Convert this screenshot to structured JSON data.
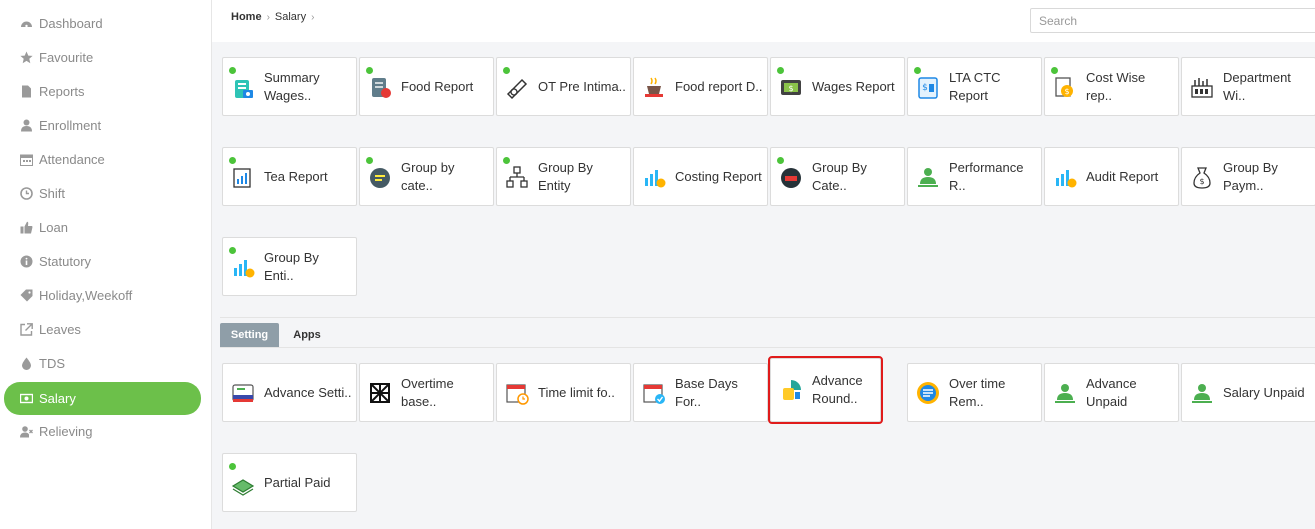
{
  "sidebar": {
    "items": [
      {
        "label": "Dashboard",
        "icon": "dashboard-icon"
      },
      {
        "label": "Favourite",
        "icon": "star-icon"
      },
      {
        "label": "Reports",
        "icon": "file-icon"
      },
      {
        "label": "Enrollment",
        "icon": "user-icon"
      },
      {
        "label": "Attendance",
        "icon": "calendar-icon"
      },
      {
        "label": "Shift",
        "icon": "clock-icon"
      },
      {
        "label": "Loan",
        "icon": "thumbs-up-icon"
      },
      {
        "label": "Statutory",
        "icon": "info-icon"
      },
      {
        "label": "Holiday,Weekoff",
        "icon": "tag-icon"
      },
      {
        "label": "Leaves",
        "icon": "external-link-icon"
      },
      {
        "label": "TDS",
        "icon": "drop-icon"
      },
      {
        "label": "Salary",
        "icon": "money-icon"
      },
      {
        "label": "Relieving",
        "icon": "user-times-icon"
      }
    ],
    "active": "Salary"
  },
  "breadcrumb": {
    "home": "Home",
    "current": "Salary"
  },
  "search": {
    "placeholder": "Search"
  },
  "reports": [
    {
      "label": "Summary Wages..",
      "icon": "summary-wages-icon"
    },
    {
      "label": "Food Report",
      "icon": "food-report-icon"
    },
    {
      "label": "OT Pre Intima..",
      "icon": "ot-pre-intimation-icon"
    },
    {
      "label": "Food report D..",
      "icon": "food-report-d-icon"
    },
    {
      "label": "Wages Report",
      "icon": "wages-report-icon"
    },
    {
      "label": "LTA CTC Report",
      "icon": "lta-ctc-icon"
    },
    {
      "label": "Cost Wise rep..",
      "icon": "cost-wise-icon"
    },
    {
      "label": "Department Wi..",
      "icon": "department-icon"
    },
    {
      "label": "Tea Report",
      "icon": "tea-report-icon"
    },
    {
      "label": "Group by cate..",
      "icon": "group-by-category-icon"
    },
    {
      "label": "Group By Entity",
      "icon": "group-by-entity-icon"
    },
    {
      "label": "Costing Report",
      "icon": "costing-report-icon"
    },
    {
      "label": "Group By Cate..",
      "icon": "group-by-cate-icon"
    },
    {
      "label": "Performance R..",
      "icon": "performance-icon"
    },
    {
      "label": "Audit Report",
      "icon": "audit-report-icon"
    },
    {
      "label": "Group By Paym..",
      "icon": "group-by-payment-icon"
    },
    {
      "label": "Group By Enti..",
      "icon": "group-by-enti-icon"
    }
  ],
  "tabs": [
    {
      "label": "Setting",
      "active": true
    },
    {
      "label": "Apps",
      "active": false
    }
  ],
  "settings": [
    {
      "label": "Advance Setti..",
      "icon": "advance-settings-icon"
    },
    {
      "label": "Overtime base..",
      "icon": "overtime-base-icon"
    },
    {
      "label": "Time limit fo..",
      "icon": "time-limit-icon"
    },
    {
      "label": "Base Days For..",
      "icon": "base-days-icon"
    },
    {
      "label": "Advance Round..",
      "icon": "advance-round-icon",
      "highlighted": true
    },
    {
      "label": "Over time Rem..",
      "icon": "overtime-rem-icon"
    },
    {
      "label": "Advance Unpaid",
      "icon": "advance-unpaid-icon"
    },
    {
      "label": "Salary Unpaid",
      "icon": "salary-unpaid-icon"
    },
    {
      "label": "Partial Paid",
      "icon": "partial-paid-icon"
    }
  ],
  "colors": {
    "accent": "#6cc04a",
    "highlight": "#e01b1b",
    "tab_active": "#8f9ea8"
  }
}
